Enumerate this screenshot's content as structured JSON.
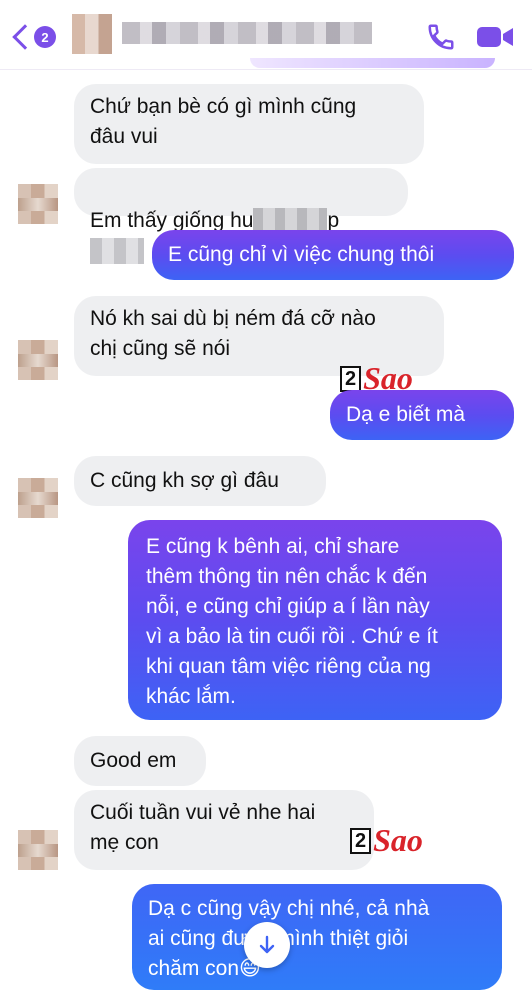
{
  "header": {
    "back_badge": "2",
    "icons": [
      "chevron-left-icon",
      "phone-icon",
      "video-camera-icon"
    ],
    "accent_color": "#7b4fe8"
  },
  "messages": [
    {
      "from": "them",
      "text": "Chứ bạn bè có gì mình cũng\nđâu vui"
    },
    {
      "from": "them",
      "text_start": "Em thấy giống hu",
      "text_mid": "p",
      "redacted": true
    },
    {
      "from": "me",
      "text": "E cũng chỉ vì việc chung thôi"
    },
    {
      "from": "them",
      "text": "Nó kh sai dù bị ném đá cỡ nào\nchị cũng sẽ nói"
    },
    {
      "from": "me",
      "text": "Dạ e biết mà"
    },
    {
      "from": "them",
      "text": "C cũng kh sợ gì đâu"
    },
    {
      "from": "me",
      "text": "E cũng k bênh ai, chỉ share\nthêm thông tin nên chắc k đến\nnỗi, e cũng chỉ giúp a í lần này\nvì a bảo là tin cuối rồi . Chứ e ít\nkhi quan tâm việc riêng của ng\nkhác lắm."
    },
    {
      "from": "them",
      "text": "Good em"
    },
    {
      "from": "them",
      "text": "Cuối tuần vui vẻ nhe hai\nmẹ con"
    },
    {
      "from": "me",
      "text": "Dạ c cũng vậy chị nhé, cả nhà\nai cũng được mình thiệt giỏi\nchăm con😄"
    }
  ],
  "watermark": {
    "num": "2",
    "word": "Sao"
  },
  "scroll_button": {
    "icon": "arrow-down-icon"
  }
}
